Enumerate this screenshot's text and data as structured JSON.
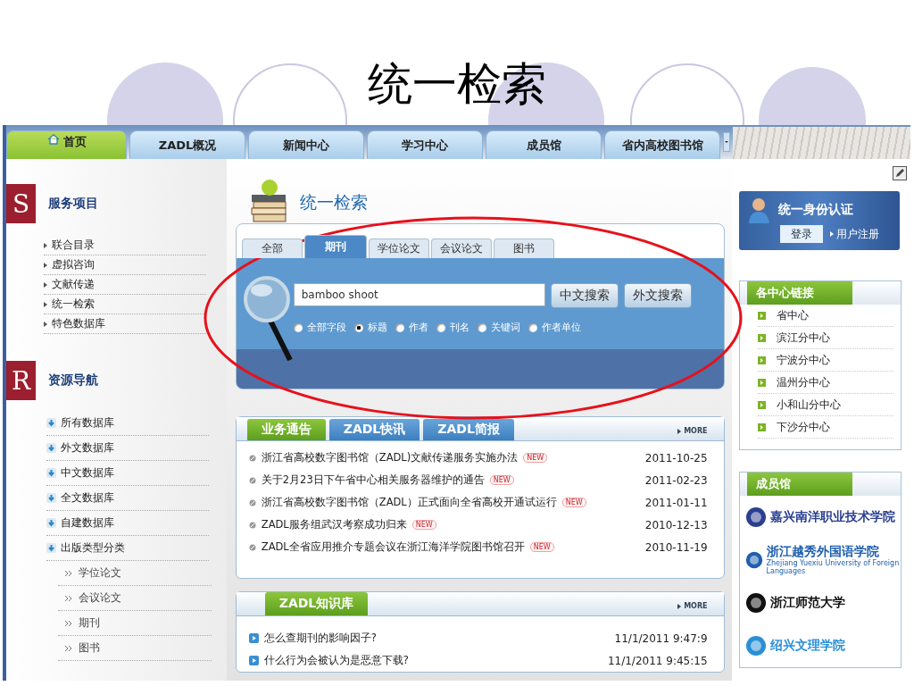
{
  "slide": {
    "title": "统一检索"
  },
  "nav": {
    "tabs": [
      {
        "label": "首页",
        "kind": "home",
        "selected": true
      },
      {
        "label": "ZADL概况",
        "kind": "plain",
        "selected": false
      },
      {
        "label": "新闻中心",
        "kind": "plain",
        "selected": false
      },
      {
        "label": "学习中心",
        "kind": "plain",
        "selected": false
      },
      {
        "label": "成员馆",
        "kind": "plain",
        "selected": false
      },
      {
        "label": "省内高校图书馆",
        "kind": "plain",
        "selected": false
      }
    ]
  },
  "sidebar": {
    "sections": [
      {
        "badge": "S",
        "title": "服务项目",
        "items": [
          {
            "label": "联合目录",
            "kind": "link"
          },
          {
            "label": "虚拟咨询",
            "kind": "link"
          },
          {
            "label": "文献传递",
            "kind": "link"
          },
          {
            "label": "统一检索",
            "kind": "link"
          },
          {
            "label": "特色数据库",
            "kind": "link"
          }
        ]
      },
      {
        "badge": "R",
        "title": "资源导航",
        "items": [
          {
            "label": "所有数据库",
            "kind": "category"
          },
          {
            "label": "外文数据库",
            "kind": "category"
          },
          {
            "label": "中文数据库",
            "kind": "category"
          },
          {
            "label": "全文数据库",
            "kind": "category"
          },
          {
            "label": "自建数据库",
            "kind": "category"
          },
          {
            "label": "出版类型分类",
            "kind": "category"
          },
          {
            "label": "学位论文",
            "kind": "sub"
          },
          {
            "label": "会议论文",
            "kind": "sub"
          },
          {
            "label": "期刊",
            "kind": "sub"
          },
          {
            "label": "图书",
            "kind": "sub"
          }
        ]
      }
    ]
  },
  "search": {
    "title": "统一检索",
    "tabs": [
      {
        "label": "全部",
        "selected": false
      },
      {
        "label": "期刊",
        "selected": true
      },
      {
        "label": "学位论文",
        "selected": false
      },
      {
        "label": "会议论文",
        "selected": false
      },
      {
        "label": "图书",
        "selected": false
      }
    ],
    "query": "bamboo shoot",
    "buttons": [
      "中文搜索",
      "外文搜索"
    ],
    "fields": [
      {
        "label": "全部字段",
        "selected": false
      },
      {
        "label": "标题",
        "selected": true
      },
      {
        "label": "作者",
        "selected": false
      },
      {
        "label": "刊名",
        "selected": false
      },
      {
        "label": "关键词",
        "selected": false
      },
      {
        "label": "作者单位",
        "selected": false
      }
    ]
  },
  "news": {
    "tabs": [
      {
        "label": "业务通告",
        "selected": true
      },
      {
        "label": "ZADL快讯",
        "selected": false
      },
      {
        "label": "ZADL简报",
        "selected": false
      }
    ],
    "more": "MORE",
    "items": [
      {
        "title": "浙江省高校数字图书馆（ZADL)文献传递服务实施办法",
        "badge": "NEW",
        "date": "2011-10-25"
      },
      {
        "title": "关于2月23日下午省中心相关服务器维护的通告",
        "badge": "NEW",
        "date": "2011-02-23"
      },
      {
        "title": "浙江省高校数字图书馆（ZADL）正式面向全省高校开通试运行",
        "badge": "NEW",
        "date": "2011-01-11"
      },
      {
        "title": "ZADL服务组武汉考察成功归来",
        "badge": "NEW",
        "date": "2010-12-13"
      },
      {
        "title": "ZADL全省应用推介专题会议在浙江海洋学院图书馆召开",
        "badge": "NEW",
        "date": "2010-11-19"
      }
    ]
  },
  "knowledge": {
    "title": "ZADL知识库",
    "more": "MORE",
    "items": [
      {
        "title": "怎么查期刊的影响因子?",
        "time": "11/1/2011 9:47:9"
      },
      {
        "title": "什么行为会被认为是恶意下载?",
        "time": "11/1/2011 9:45:15"
      }
    ]
  },
  "auth": {
    "title": "统一身份认证",
    "login": "登录",
    "register": "用户注册"
  },
  "centers": {
    "title": "各中心链接",
    "items": [
      "省中心",
      "滨江分中心",
      "宁波分中心",
      "温州分中心",
      "小和山分中心",
      "下沙分中心"
    ]
  },
  "members": {
    "title": "成员馆",
    "items": [
      {
        "name": "嘉兴南洋职业技术学院",
        "color": "#2a3f8f"
      },
      {
        "name": "浙江越秀外国语学院",
        "subtitle": "Zhejiang Yuexiu University of Foreign Languages",
        "color": "#1f5fae"
      },
      {
        "name": "浙江师范大学",
        "color": "#111111"
      },
      {
        "name": "绍兴文理学院",
        "color": "#2b8fd6"
      }
    ]
  }
}
